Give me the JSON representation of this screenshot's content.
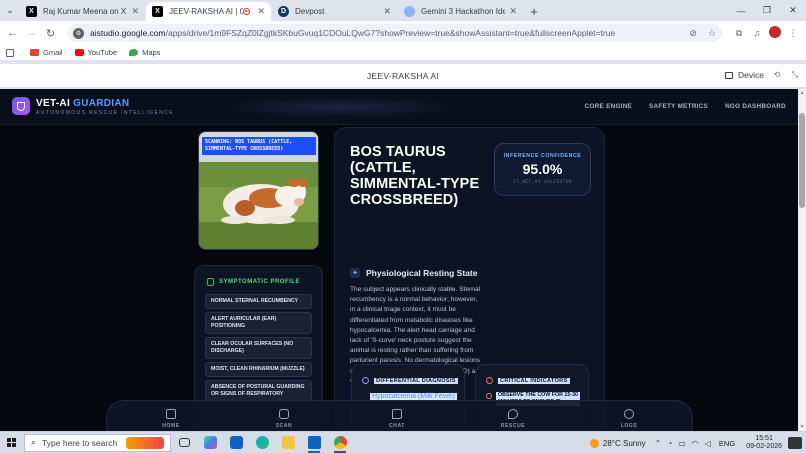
{
  "browser": {
    "tabs": [
      {
        "title": "Raj Kumar Meena on X: \"@sau",
        "icon": "x-logo-icon",
        "active": false
      },
      {
        "title": "JEEV-RAKSHA AI | Google A",
        "icon": "x-logo-icon",
        "active": true
      },
      {
        "title": "Devpost",
        "icon": "devpost-icon",
        "active": false
      },
      {
        "title": "Gemini 3 Hackathon Ideas",
        "icon": "gemini-icon",
        "active": false
      }
    ],
    "url_main": "aistudio.google.com",
    "url_rest": "/apps/drive/1m9FSZqZ0lZgjtkSKbuGvuq1CDOuLQwG7?showPreview=true&showAssistant=true&fullscreenApplet=true",
    "bookmarks": [
      "Gmail",
      "YouTube",
      "Maps"
    ],
    "page_title": "JEEV-RAKSHA AI",
    "device_label": "Device"
  },
  "app": {
    "brand": {
      "name_part1": "VET-AI",
      "name_part2": "GUARDIAN",
      "tagline": "AUTONOMOUS RESCUE INTELLIGENCE"
    },
    "nav": [
      "CORE ENGINE",
      "SAFETY METRICS",
      "NGO DASHBOARD"
    ],
    "scan_label": "SCANNING: BOS TAURUS (CATTLE, SIMMENTAL-TYPE CROSSBREED)",
    "symptoms": {
      "title": "SYMPTOMATIC PROFILE",
      "items": [
        "NORMAL STERNAL RECUMBENCY",
        "ALERT AURICULAR (EAR) POSITIONING",
        "CLEAR OCULAR SURFACES (NO DISCHARGE)",
        "MOIST, CLEAN RHINARIUM (MUZZLE)",
        "ABSENCE OF POSTURAL GUARDING OR SIGNS OF RESPIRATORY"
      ]
    },
    "species_title": "BOS TAURUS (CATTLE, SIMMENTAL-TYPE CROSSBREED)",
    "confidence": {
      "label": "INFERENCE CONFIDENCE",
      "value": "95.0%",
      "sub": "ST_NET_V1 VALIDATED"
    },
    "state": "Physiological Resting State",
    "description": "The subject appears clinically stable. Sternal recumbency is a normal behavior; however, in a clinical triage context, it must be differentiated from metabolic diseases like hypocalcemia. The alert head carriage and lack of 'S-curve' neck posture suggest the animal is resting rather than suffering from parturient paresis. No dermatological lesions suggestive of Lumpy Skin Disease (LSD) are visible.",
    "differential": {
      "title": "DIFFERENTIAL DIAGNOSIS",
      "item": "Hypocalcemia (Milk Fever)"
    },
    "critical": {
      "title": "CRITICAL INDICATORS",
      "item": "OBSERVE THE COW FOR 15-30 MINUTES TO ENSURE IT"
    },
    "dock": [
      "HOME",
      "SCAN",
      "CHAT",
      "RESCUE",
      "LOGS"
    ]
  },
  "taskbar": {
    "search_placeholder": "Type here to search",
    "weather": "28°C  Sunny",
    "lang": "ENG",
    "time": "15:51",
    "date": "09-02-2026"
  }
}
